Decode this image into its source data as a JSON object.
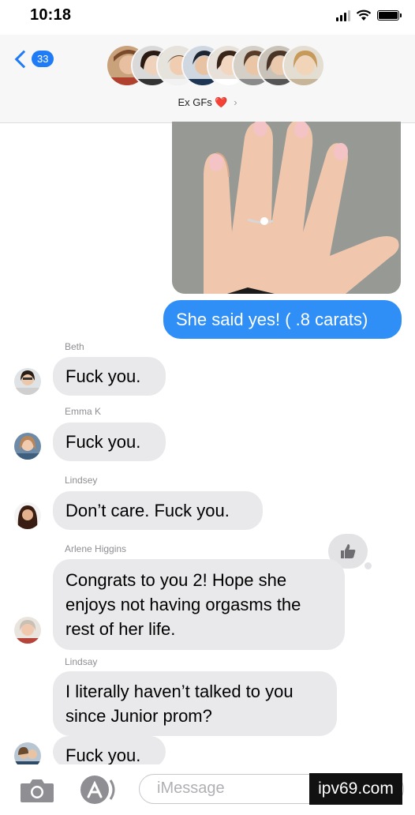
{
  "status_bar": {
    "time": "10:18"
  },
  "header": {
    "back_badge": "33",
    "group_name": "Ex GFs",
    "group_emoji": "❤️",
    "participant_avatars": 8
  },
  "messages": [
    {
      "type": "image",
      "from": "me",
      "description": "photo of hand with ring"
    },
    {
      "type": "text",
      "from": "me",
      "text": "She said yes! ( .8 carats)"
    },
    {
      "type": "text",
      "from": "Beth",
      "sender_label": "Beth",
      "text": "Fuck you."
    },
    {
      "type": "text",
      "from": "Emma K",
      "sender_label": "Emma K",
      "text": "Fuck you."
    },
    {
      "type": "text",
      "from": "Lindsey",
      "sender_label": "Lindsey",
      "text": "Don’t care. Fuck you."
    },
    {
      "type": "text",
      "from": "Arlene Higgins",
      "sender_label": "Arlene  Higgins",
      "lines": [
        "Congrats to you 2! Hope she",
        "enjoys not having orgasms the",
        "rest of her life."
      ],
      "reaction": "thumbs-up"
    },
    {
      "type": "text",
      "from": "Lindsay",
      "sender_label": "Lindsay",
      "lines": [
        "I literally haven’t talked to you",
        "since Junior prom?"
      ]
    },
    {
      "type": "text",
      "from": "unknown",
      "text": "Fuck you."
    }
  ],
  "input": {
    "placeholder": "iMessage"
  },
  "watermark": "ipv69.com",
  "colors": {
    "accent": "#1f7cf6",
    "outgoing_bubble": "#2f8ff7",
    "incoming_bubble": "#e9e9eb"
  }
}
